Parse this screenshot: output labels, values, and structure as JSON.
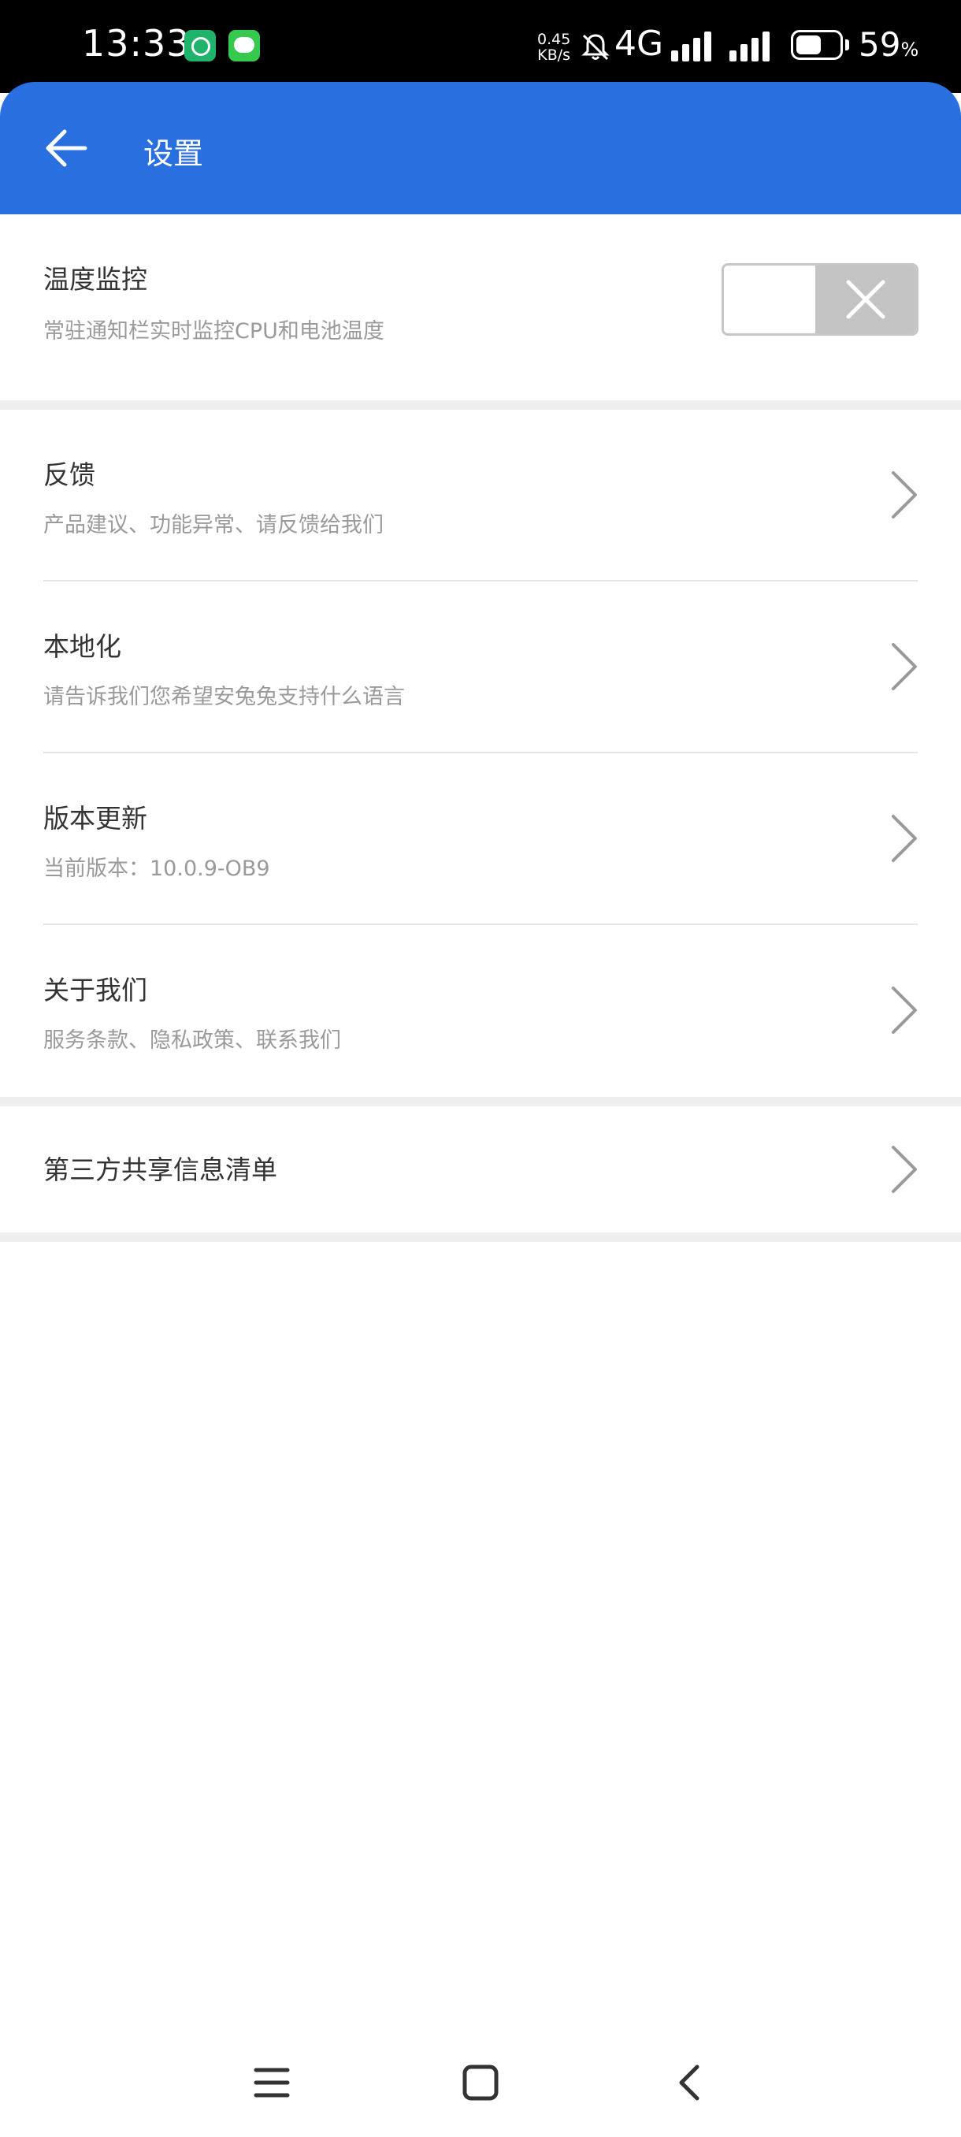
{
  "status_bar": {
    "time": "13:33",
    "net_speed_value": "0.45",
    "net_speed_unit": "KB/s",
    "network_type": "4G",
    "battery_percent": "59",
    "battery_unit": "%",
    "battery_level": 0.59,
    "notification_icons": [
      "360-security-icon",
      "wechat-icon"
    ]
  },
  "app_bar": {
    "title": "设置",
    "background_color": "#2a6fe0"
  },
  "settings": {
    "temperature": {
      "title": "温度监控",
      "subtitle": "常驻通知栏实时监控CPU和电池温度",
      "toggle_state": "off"
    },
    "feedback": {
      "title": "反馈",
      "subtitle": "产品建议、功能异常、请反馈给我们"
    },
    "localization": {
      "title": "本地化",
      "subtitle": "请告诉我们您希望安兔兔支持什么语言"
    },
    "version_update": {
      "title": "版本更新",
      "subtitle": "当前版本：10.0.9-OB9"
    },
    "about": {
      "title": "关于我们",
      "subtitle": "服务条款、隐私政策、联系我们"
    },
    "third_party": {
      "title": "第三方共享信息清单"
    }
  },
  "nav_bar": {
    "buttons": [
      "menu-icon",
      "home-icon",
      "back-icon"
    ]
  }
}
